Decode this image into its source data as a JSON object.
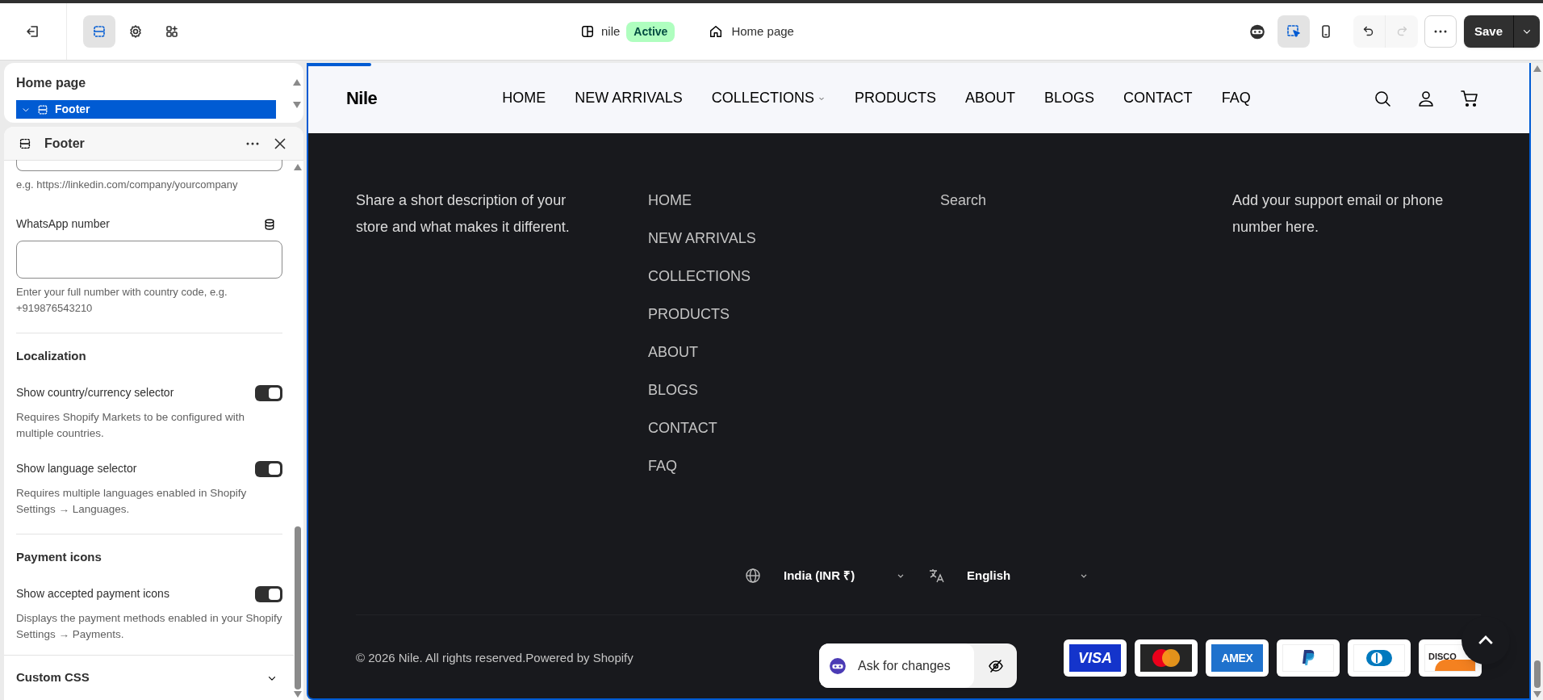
{
  "topbar": {
    "tools": [
      {
        "kind": "sections",
        "selected": true
      },
      {
        "kind": "settings",
        "selected": false
      },
      {
        "kind": "apps",
        "selected": false
      }
    ],
    "store": {
      "name": "nile",
      "badge": "Active"
    },
    "page": "Home page",
    "view_tools": [
      {
        "kind": "inspector",
        "selected": true
      },
      {
        "kind": "mobile",
        "selected": false
      }
    ],
    "redo_disabled": true,
    "save": "Save"
  },
  "sidebar": {
    "title": "Home page",
    "tree_item": {
      "label": "Footer",
      "expanded": true,
      "selected": true
    }
  },
  "settings_panel": {
    "title": "Footer",
    "linkedin_hint": "e.g. https://linkedin.com/company/yourcompany",
    "whatsapp": {
      "label": "WhatsApp number",
      "hint": "Enter your full number with country code, e.g. +919876543210"
    },
    "sections": [
      {
        "title": "Localization",
        "toggles": [
          {
            "label": "Show country/currency selector",
            "description": "Requires Shopify Markets to be configured with multiple countries.",
            "on": true
          },
          {
            "label": "Show language selector",
            "description": "Requires multiple languages enabled in Shopify Settings → Languages.",
            "on": true
          }
        ]
      },
      {
        "title": "Payment icons",
        "toggles": [
          {
            "label": "Show accepted payment icons",
            "description": "Displays the payment methods enabled in your Shopify Settings → Payments.",
            "on": true
          }
        ]
      }
    ],
    "collapsed": {
      "title": "Custom CSS",
      "expanded": false
    }
  },
  "preview": {
    "logo": "Nile",
    "nav": [
      {
        "label": "HOME",
        "dropdown": false
      },
      {
        "label": "NEW ARRIVALS",
        "dropdown": false
      },
      {
        "label": "COLLECTIONS",
        "dropdown": true
      },
      {
        "label": "PRODUCTS",
        "dropdown": false
      },
      {
        "label": "ABOUT",
        "dropdown": false
      },
      {
        "label": "BLOGS",
        "dropdown": false
      },
      {
        "label": "CONTACT",
        "dropdown": false
      },
      {
        "label": "FAQ",
        "dropdown": false
      }
    ],
    "footer": {
      "description": "Share a short description of your store and what makes it different.",
      "shop_links": [
        "HOME",
        "NEW ARRIVALS",
        "COLLECTIONS",
        "PRODUCTS",
        "ABOUT",
        "BLOGS",
        "CONTACT",
        "FAQ"
      ],
      "customer_care_links": [
        "Search"
      ],
      "contact": "Add your support email or phone number here.",
      "country": "India (INR ₹)",
      "language": "English",
      "copyright": "© 2026 Nile. All rights reserved.Powered by Shopify",
      "payments": [
        {
          "kind": "visa",
          "label": "VISA"
        },
        {
          "kind": "mastercard"
        },
        {
          "kind": "amex",
          "label": "AMEX"
        },
        {
          "kind": "paypal"
        },
        {
          "kind": "diners"
        },
        {
          "kind": "discover",
          "label": "DISCO"
        }
      ]
    },
    "ask": {
      "label": "Ask for changes"
    }
  }
}
